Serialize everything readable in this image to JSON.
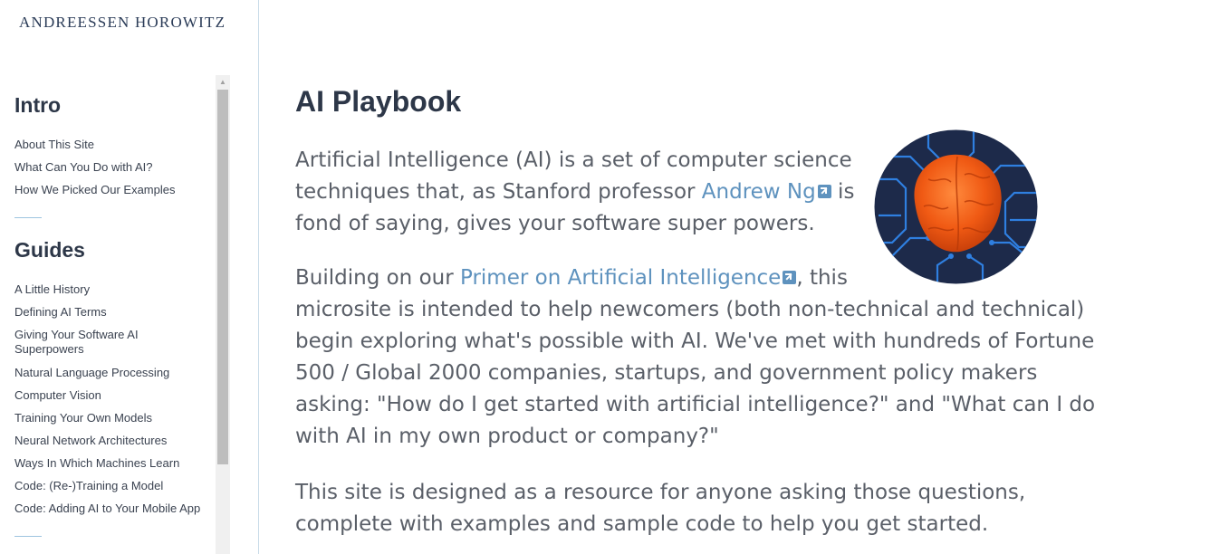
{
  "brand": {
    "logo_text": "ANDREESSEN HOROWITZ"
  },
  "sidebar": {
    "sections": [
      {
        "heading": "Intro",
        "items": [
          "About This Site",
          "What Can You Do with AI?",
          "How We Picked Our Examples"
        ]
      },
      {
        "heading": "Guides",
        "items": [
          "A Little History",
          "Defining AI Terms",
          "Giving Your Software AI Superpowers",
          "Natural Language Processing",
          "Computer Vision",
          "Training Your Own Models",
          "Neural Network Architectures",
          "Ways In Which Machines Learn",
          "Code: (Re-)Training a Model",
          "Code: Adding AI to Your Mobile App"
        ]
      }
    ]
  },
  "main": {
    "title": "AI Playbook",
    "p1": {
      "line1": "Artificial Intelligence (AI) is a set of computer science",
      "line2_pre": "techniques that, as Stanford professor ",
      "line2_link": "Andrew Ng",
      "line2_post": " is",
      "line3": "fond of saying, gives your software super powers."
    },
    "p2": {
      "pre": "Building on our ",
      "link": "Primer on Artificial Intelligence",
      "post": ", this",
      "line2": "microsite is intended to help newcomers (both non-technical and technical)",
      "line3": "begin exploring what's possible with AI. We've met with hundreds of Fortune",
      "line4": "500 / Global 2000 companies, startups, and government policy makers",
      "line5": "asking: \"How do I get started with artificial intelligence?\" and \"What can I do",
      "line6": "with AI in my own product or company?\""
    },
    "p3": {
      "line1": "This site is designed as a resource for anyone asking those questions,",
      "line2": "complete with examples and sample code to help you get started."
    }
  },
  "colors": {
    "link": "#5e92be",
    "heading": "#2d3748",
    "body_text": "#5a5f68",
    "divider": "#9ec4e0"
  },
  "icons": [
    "external-link-icon",
    "brain-circuit-image",
    "scroll-up-arrow-icon"
  ]
}
